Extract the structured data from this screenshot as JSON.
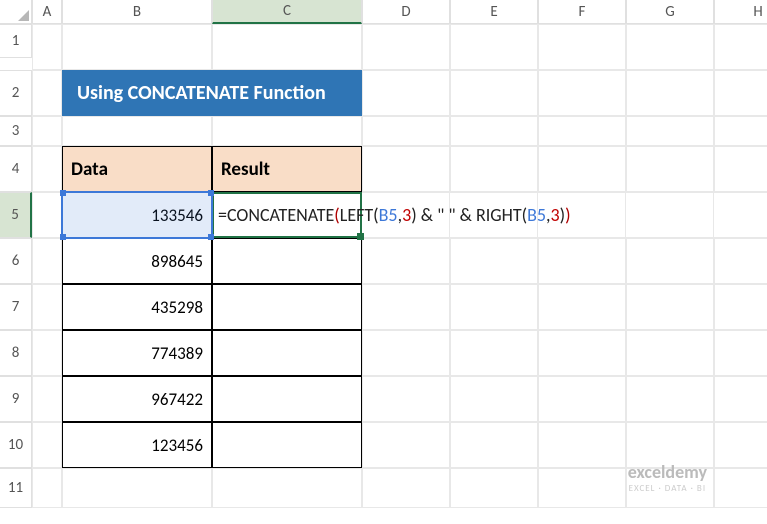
{
  "columns": [
    "A",
    "B",
    "C",
    "D",
    "E",
    "F",
    "G",
    "H"
  ],
  "rows": [
    "1",
    "2",
    "3",
    "4",
    "5",
    "6",
    "7",
    "8",
    "9",
    "10",
    "11"
  ],
  "selected_column": "C",
  "selected_row": "5",
  "title": "Using CONCATENATE Function",
  "headers": {
    "data": "Data",
    "result": "Result"
  },
  "data_values": [
    "133546",
    "898645",
    "435298",
    "774389",
    "967422",
    "123456"
  ],
  "formula": {
    "prefix": "=CONCATENATE",
    "p1o": "(",
    "fn_left": "LEFT",
    "p2o": "(",
    "ref1": "B5",
    "comma1": ",",
    "num1": "3",
    "p2c": ")",
    "amp_q": " & \" \" & ",
    "fn_right": "RIGHT",
    "p3o": "(",
    "ref2": "B5",
    "comma2": ",",
    "num2": "3",
    "p3c": ")",
    "p1c": ")"
  },
  "watermark": {
    "main": "exceldemy",
    "sub": "EXCEL · DATA · BI"
  }
}
